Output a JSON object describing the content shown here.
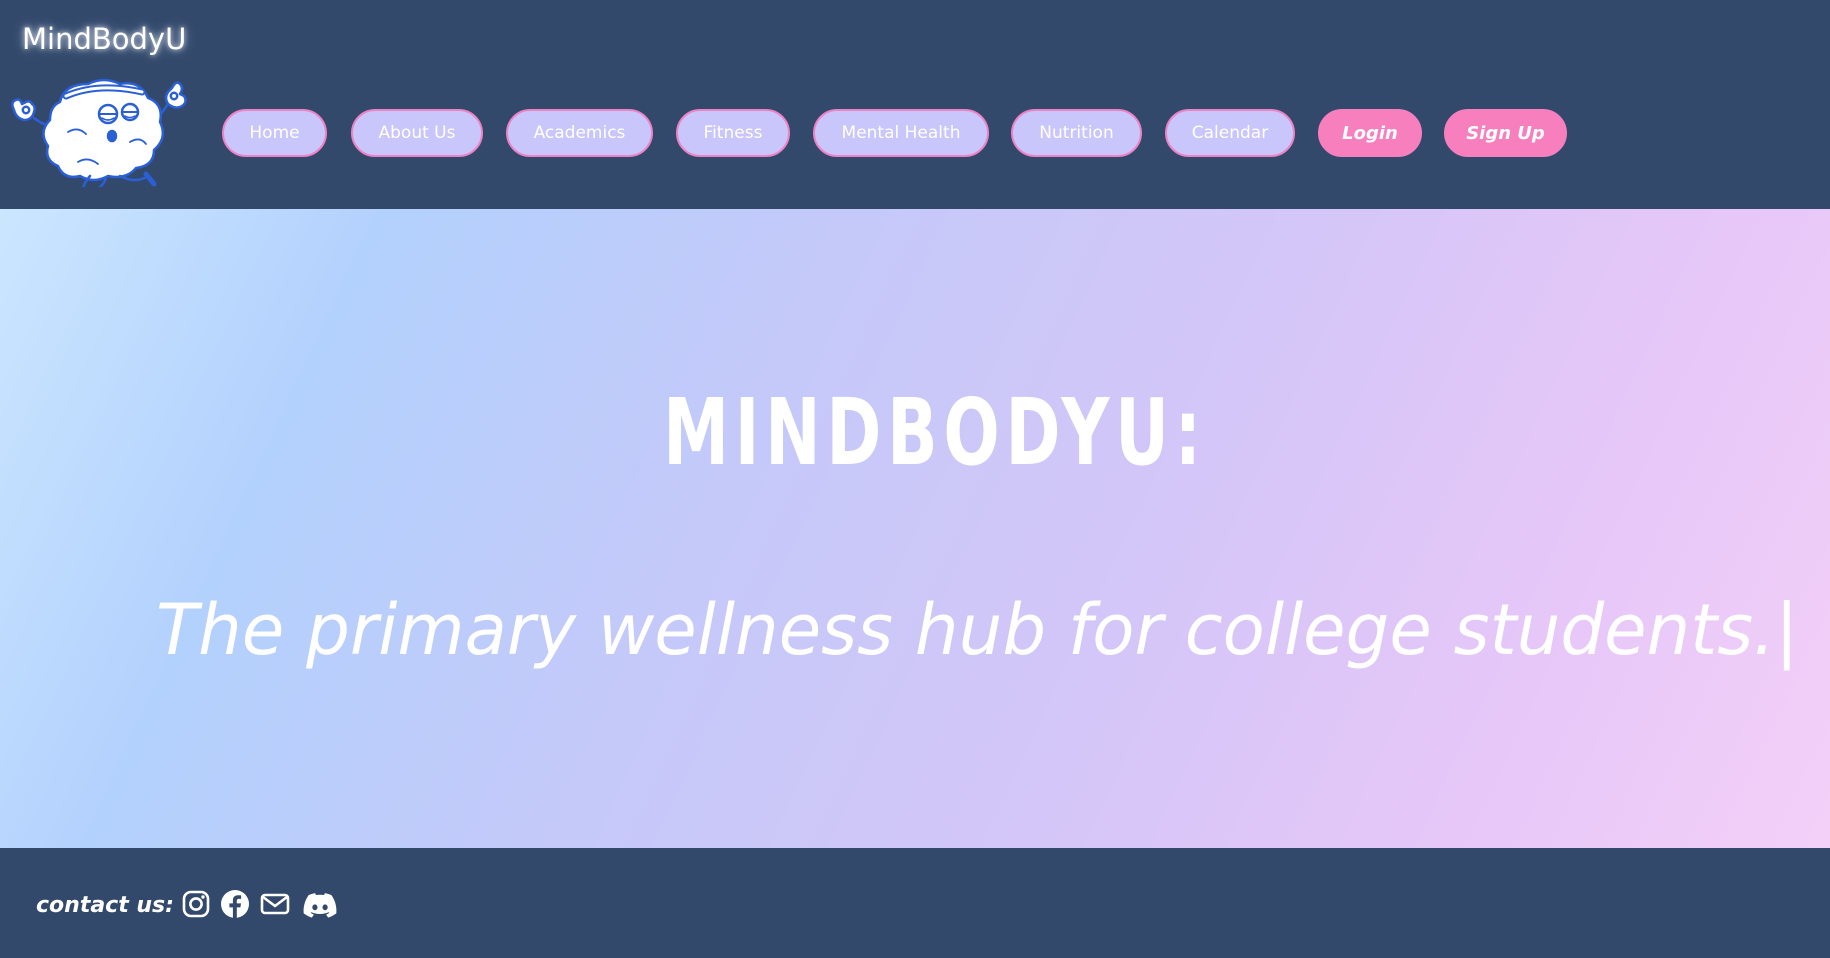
{
  "brand": {
    "name": "MindBodyU"
  },
  "nav": {
    "items": [
      {
        "label": "Home",
        "icon": "none"
      },
      {
        "label": "About Us",
        "icon": "none"
      },
      {
        "label": "Academics",
        "icon": "none"
      },
      {
        "label": "Fitness",
        "icon": "none"
      },
      {
        "label": "Mental Health",
        "icon": "none"
      },
      {
        "label": "Nutrition",
        "icon": "none"
      },
      {
        "label": "Calendar",
        "icon": "none"
      }
    ],
    "login_label": "Login",
    "signup_label": "Sign Up"
  },
  "hero": {
    "title": "MINDBODYU:",
    "tagline": "The primary wellness hub for college students.",
    "cursor": "|"
  },
  "footer": {
    "contact_label": "contact us:",
    "social_icons": [
      "instagram-icon",
      "facebook-icon",
      "email-icon",
      "discord-icon"
    ]
  },
  "colors": {
    "header_bg": "#33496b",
    "nav_button_bg": "#c9c6fb",
    "nav_button_border": "#ee82c7",
    "cta_bg": "#f77fbe",
    "text": "#ffffff"
  }
}
